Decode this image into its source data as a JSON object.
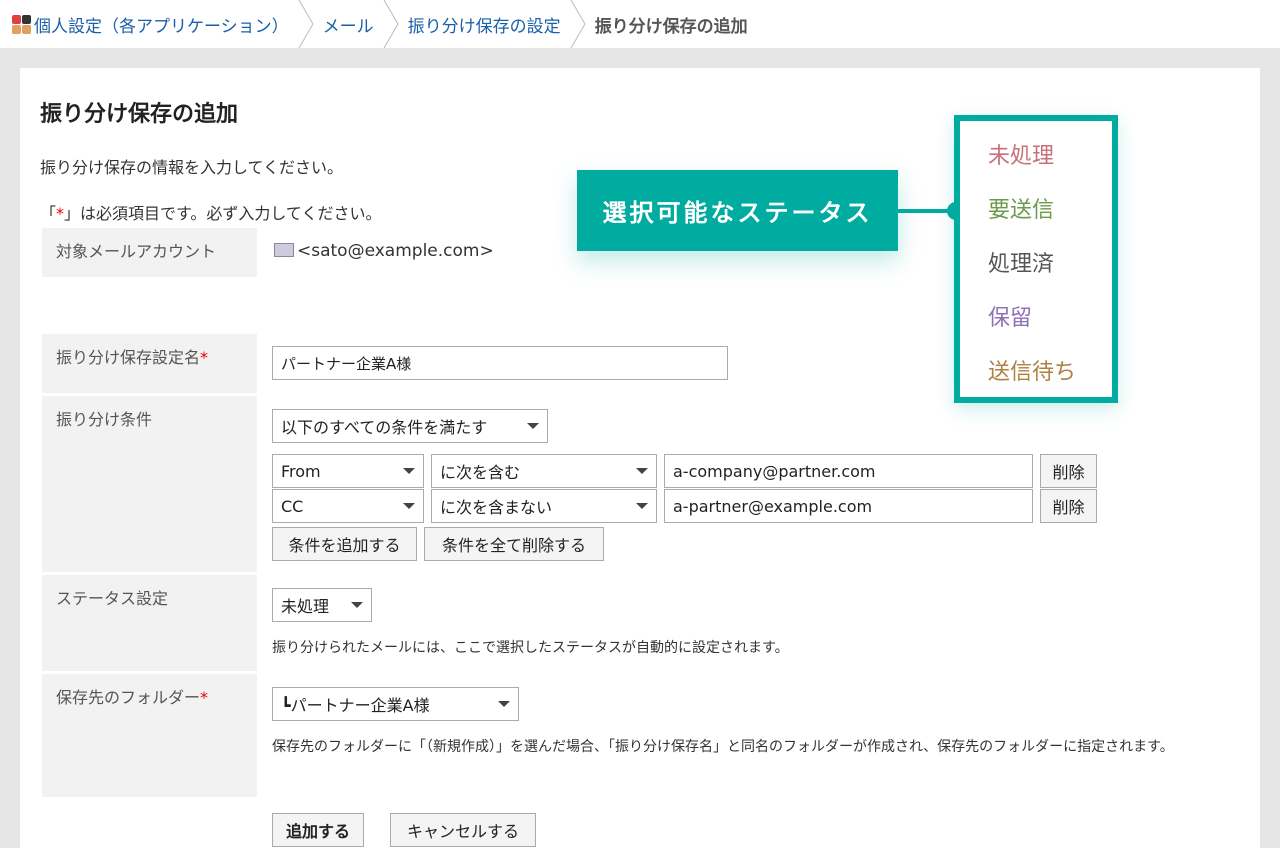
{
  "breadcrumb": [
    {
      "label": "個人設定（各アプリケーション）"
    },
    {
      "label": "メール"
    },
    {
      "label": "振り分け保存の設定"
    },
    {
      "label": "振り分け保存の追加"
    }
  ],
  "page": {
    "title": "振り分け保存の追加",
    "intro": "振り分け保存の情報を入力してください。",
    "required_prefix": "「",
    "required_mark": "*",
    "required_suffix": "」は必須項目です。必ず入力してください。"
  },
  "form": {
    "account": {
      "label": "対象メールアカウント",
      "value": "<sato@example.com>",
      "icon": "mail-account-icon"
    },
    "name": {
      "label": "振り分け保存設定名",
      "required": "*",
      "value": "パートナー企業A様"
    },
    "conditions": {
      "label": "振り分け条件",
      "match": "以下のすべての条件を満たす",
      "rows": [
        {
          "field": "From",
          "operator": "に次を含む",
          "value": "a-company@partner.com",
          "delete": "削除"
        },
        {
          "field": "CC",
          "operator": "に次を含まない",
          "value": "a-partner@example.com",
          "delete": "削除"
        }
      ],
      "add": "条件を追加する",
      "clear": "条件を全て削除する"
    },
    "status": {
      "label": "ステータス設定",
      "value": "未処理",
      "note": "振り分けられたメールには、ここで選択したステータスが自動的に設定されます。"
    },
    "folder": {
      "label": "保存先のフォルダー",
      "required": "*",
      "value": "┗パートナー企業A様",
      "note": "保存先のフォルダーに「（新規作成）」を選んだ場合、「振り分け保存名」と同名のフォルダーが作成され、保存先のフォルダーに指定されます。"
    },
    "submit": "追加する",
    "cancel": "キャンセルする"
  },
  "callout": {
    "label": "選択可能なステータス",
    "accent": "#00aba0",
    "statuses": [
      {
        "label": "未処理",
        "color": "#c8707a"
      },
      {
        "label": "要送信",
        "color": "#6a9a4a"
      },
      {
        "label": "処理済",
        "color": "#555555"
      },
      {
        "label": "保留",
        "color": "#9070b8"
      },
      {
        "label": "送信待ち",
        "color": "#b08040"
      }
    ]
  }
}
